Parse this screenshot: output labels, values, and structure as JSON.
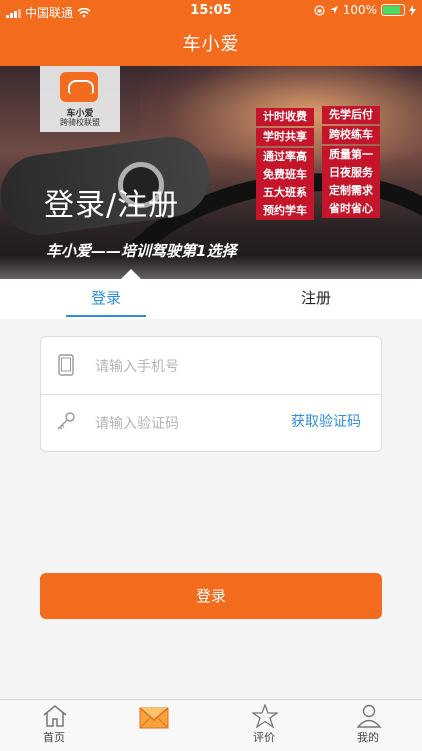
{
  "status": {
    "carrier": "中国联通",
    "time": "15:05",
    "battery": "100%"
  },
  "nav": {
    "title": "车小爱"
  },
  "banner": {
    "logo_line1": "车小爱",
    "logo_line2": "跨骑校联盟",
    "title": "登录/注册",
    "subtitle": "车小爱——培训驾驶第1选择",
    "ribbons": [
      "计时收费",
      "先学后付",
      "学时共享",
      "跨校练车",
      "通过率高",
      "质量第一",
      "免费班车",
      "日夜服务",
      "五大班系",
      "定制需求",
      "预约学车",
      "省时省心"
    ]
  },
  "tabs": {
    "login": "登录",
    "register": "注册"
  },
  "form": {
    "phone_placeholder": "请输入手机号",
    "code_placeholder": "请输入验证码",
    "get_code": "获取验证码"
  },
  "actions": {
    "login": "登录"
  },
  "tabbar": {
    "home": "首页",
    "rate": "评价",
    "mine": "我的"
  },
  "colors": {
    "brand": "#f36b1c",
    "link": "#2c8ee0"
  }
}
